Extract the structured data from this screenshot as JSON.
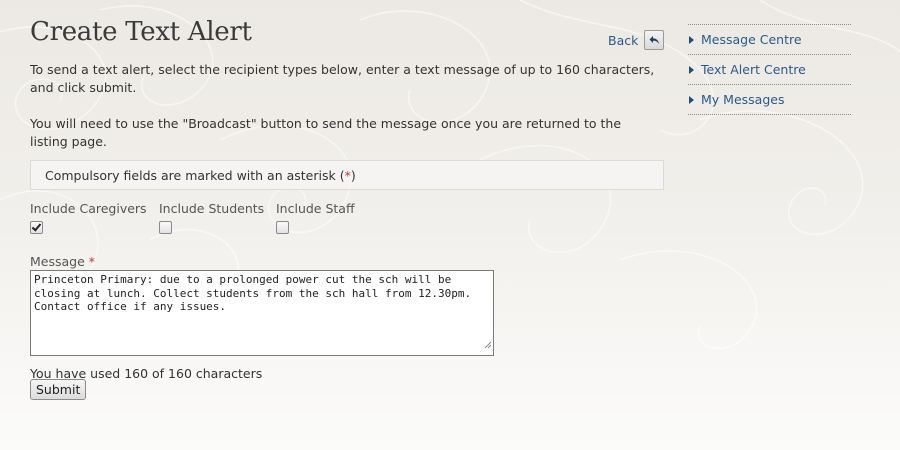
{
  "page": {
    "title": "Create Text Alert",
    "back_label": "Back",
    "back_icon": "reply-arrow-icon",
    "intro": "To send a text alert, select the recipient types below, enter a text message of up to 160 characters, and click submit.",
    "broadcast_note": "You will need to use the \"Broadcast\" button to send the message once you are returned to the listing page."
  },
  "notice": {
    "text": "Compulsory fields are marked with an asterisk (",
    "asterisk": "*",
    "close": ")"
  },
  "recipients": [
    {
      "label": "Include Caregivers",
      "checked": true
    },
    {
      "label": "Include Students",
      "checked": false
    },
    {
      "label": "Include Staff",
      "checked": false
    }
  ],
  "message": {
    "label": "Message",
    "required_marker": "*",
    "value": "Princeton Primary: due to a prolonged power cut the sch will be closing at lunch. Collect students from the sch hall from 12.30pm. Contact office if any issues."
  },
  "counter": "You have used 160 of 160 characters",
  "submit_label": "Submit",
  "sidebar": {
    "items": [
      {
        "label": "Message Centre"
      },
      {
        "label": "Text Alert Centre"
      },
      {
        "label": "My Messages"
      }
    ]
  },
  "colors": {
    "link": "#2a5a8a",
    "required": "#c0392b",
    "nav_triangle": "#1f4d7a"
  }
}
